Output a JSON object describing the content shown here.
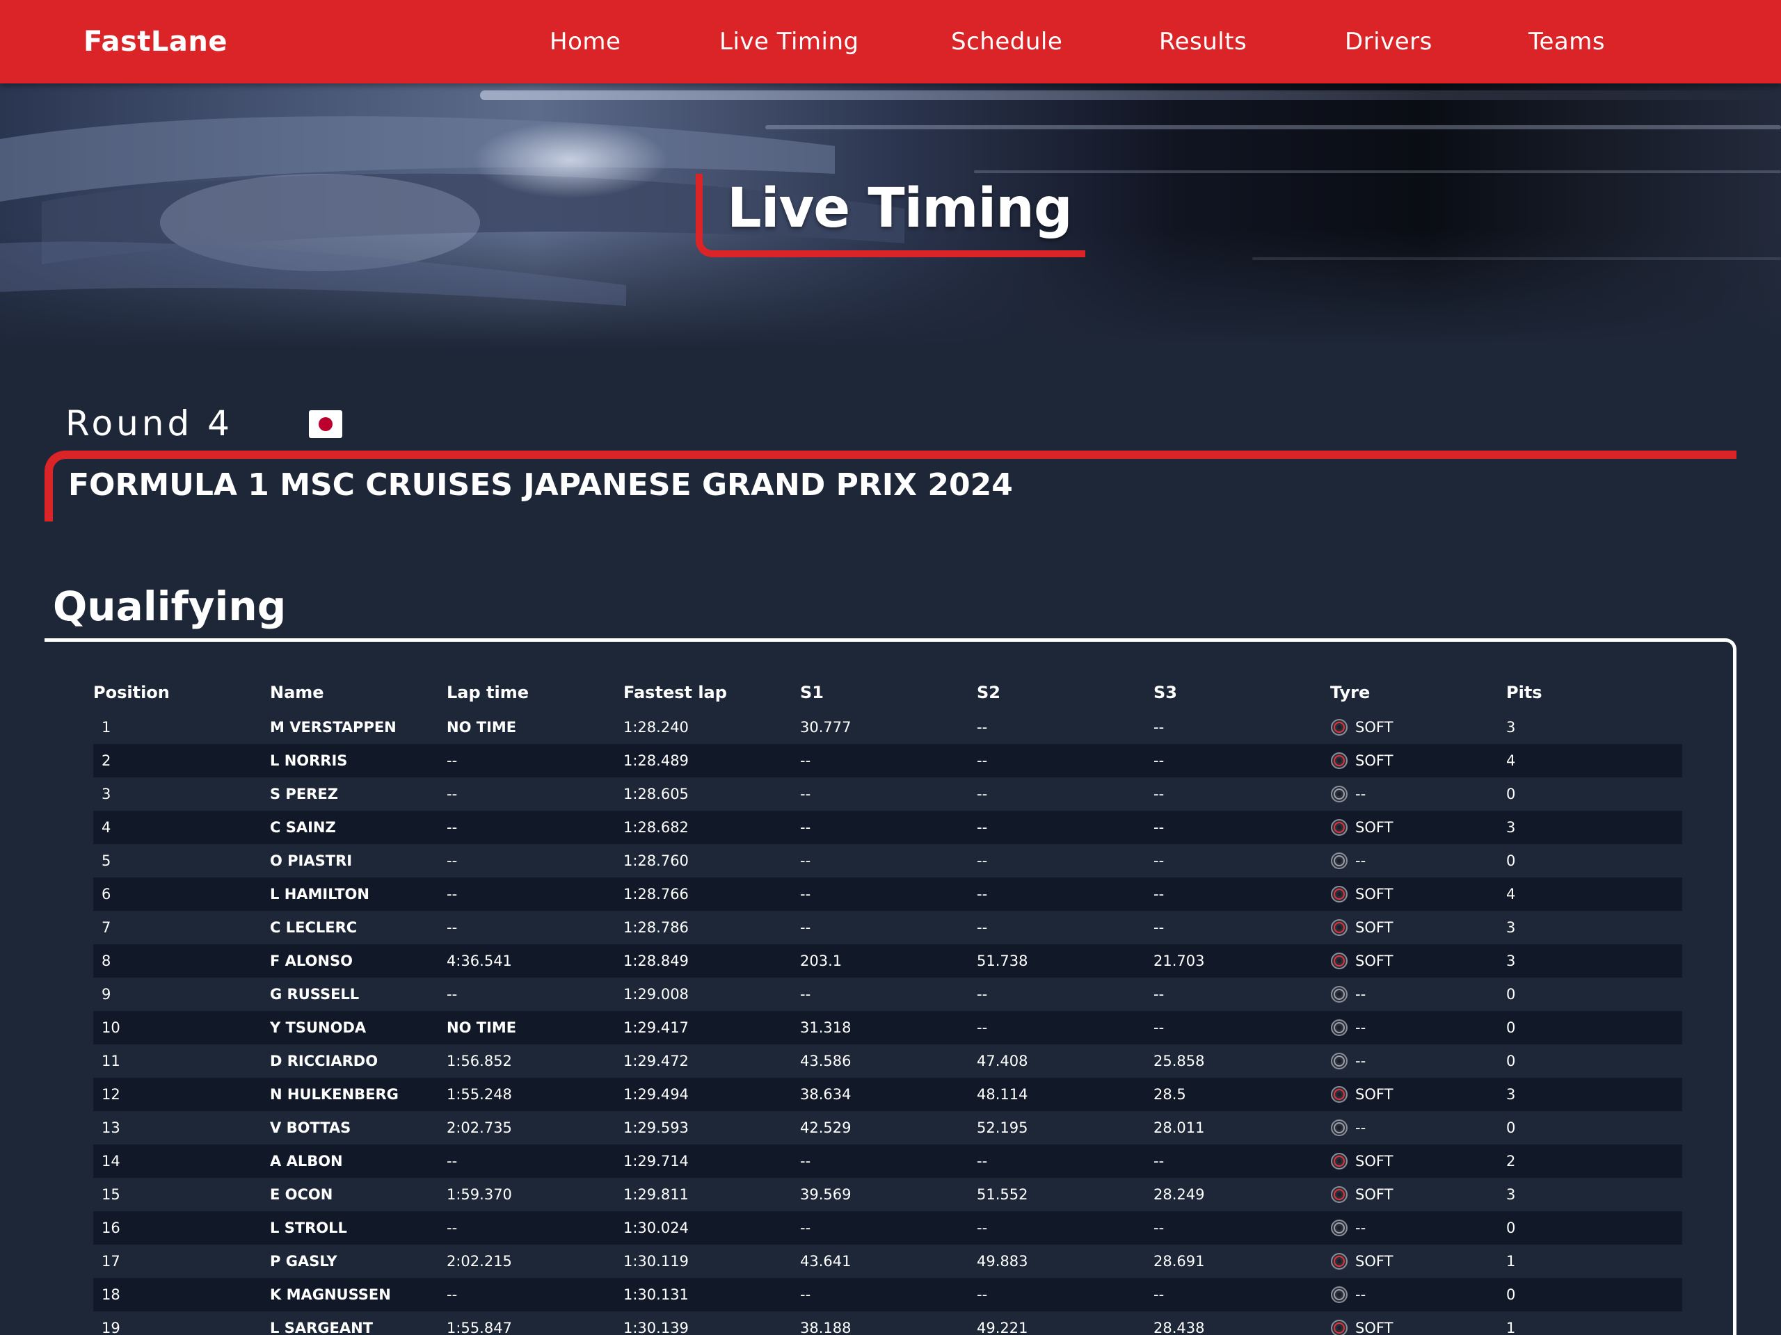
{
  "brand": "FastLane",
  "nav": [
    "Home",
    "Live Timing",
    "Schedule",
    "Results",
    "Drivers",
    "Teams"
  ],
  "hero": {
    "title": "Live Timing"
  },
  "event": {
    "round": "Round 4",
    "title": "FORMULA 1 MSC CRUISES JAPANESE GRAND PRIX 2024"
  },
  "session": {
    "title": "Qualifying"
  },
  "table": {
    "headers": [
      "Position",
      "Name",
      "Lap time",
      "Fastest lap",
      "S1",
      "S2",
      "S3",
      "Tyre",
      "Pits"
    ],
    "rows": [
      {
        "pos": "1",
        "name": "M VERSTAPPEN",
        "lap": "NO TIME",
        "fastest": "1:28.240",
        "s1": "30.777",
        "s2": "--",
        "s3": "--",
        "tyre": "SOFT",
        "pits": "3"
      },
      {
        "pos": "2",
        "name": "L NORRIS",
        "lap": "--",
        "fastest": "1:28.489",
        "s1": "--",
        "s2": "--",
        "s3": "--",
        "tyre": "SOFT",
        "pits": "4"
      },
      {
        "pos": "3",
        "name": "S PEREZ",
        "lap": "--",
        "fastest": "1:28.605",
        "s1": "--",
        "s2": "--",
        "s3": "--",
        "tyre": "--",
        "pits": "0"
      },
      {
        "pos": "4",
        "name": "C SAINZ",
        "lap": "--",
        "fastest": "1:28.682",
        "s1": "--",
        "s2": "--",
        "s3": "--",
        "tyre": "SOFT",
        "pits": "3"
      },
      {
        "pos": "5",
        "name": "O PIASTRI",
        "lap": "--",
        "fastest": "1:28.760",
        "s1": "--",
        "s2": "--",
        "s3": "--",
        "tyre": "--",
        "pits": "0"
      },
      {
        "pos": "6",
        "name": "L HAMILTON",
        "lap": "--",
        "fastest": "1:28.766",
        "s1": "--",
        "s2": "--",
        "s3": "--",
        "tyre": "SOFT",
        "pits": "4"
      },
      {
        "pos": "7",
        "name": "C LECLERC",
        "lap": "--",
        "fastest": "1:28.786",
        "s1": "--",
        "s2": "--",
        "s3": "--",
        "tyre": "SOFT",
        "pits": "3"
      },
      {
        "pos": "8",
        "name": "F ALONSO",
        "lap": "4:36.541",
        "fastest": "1:28.849",
        "s1": "203.1",
        "s2": "51.738",
        "s3": "21.703",
        "tyre": "SOFT",
        "pits": "3"
      },
      {
        "pos": "9",
        "name": "G RUSSELL",
        "lap": "--",
        "fastest": "1:29.008",
        "s1": "--",
        "s2": "--",
        "s3": "--",
        "tyre": "--",
        "pits": "0"
      },
      {
        "pos": "10",
        "name": "Y TSUNODA",
        "lap": "NO TIME",
        "fastest": "1:29.417",
        "s1": "31.318",
        "s2": "--",
        "s3": "--",
        "tyre": "--",
        "pits": "0"
      },
      {
        "pos": "11",
        "name": "D RICCIARDO",
        "lap": "1:56.852",
        "fastest": "1:29.472",
        "s1": "43.586",
        "s2": "47.408",
        "s3": "25.858",
        "tyre": "--",
        "pits": "0"
      },
      {
        "pos": "12",
        "name": "N HULKENBERG",
        "lap": "1:55.248",
        "fastest": "1:29.494",
        "s1": "38.634",
        "s2": "48.114",
        "s3": "28.5",
        "tyre": "SOFT",
        "pits": "3"
      },
      {
        "pos": "13",
        "name": "V BOTTAS",
        "lap": "2:02.735",
        "fastest": "1:29.593",
        "s1": "42.529",
        "s2": "52.195",
        "s3": "28.011",
        "tyre": "--",
        "pits": "0"
      },
      {
        "pos": "14",
        "name": "A ALBON",
        "lap": "--",
        "fastest": "1:29.714",
        "s1": "--",
        "s2": "--",
        "s3": "--",
        "tyre": "SOFT",
        "pits": "2"
      },
      {
        "pos": "15",
        "name": "E OCON",
        "lap": "1:59.370",
        "fastest": "1:29.811",
        "s1": "39.569",
        "s2": "51.552",
        "s3": "28.249",
        "tyre": "SOFT",
        "pits": "3"
      },
      {
        "pos": "16",
        "name": "L STROLL",
        "lap": "--",
        "fastest": "1:30.024",
        "s1": "--",
        "s2": "--",
        "s3": "--",
        "tyre": "--",
        "pits": "0"
      },
      {
        "pos": "17",
        "name": "P GASLY",
        "lap": "2:02.215",
        "fastest": "1:30.119",
        "s1": "43.641",
        "s2": "49.883",
        "s3": "28.691",
        "tyre": "SOFT",
        "pits": "1"
      },
      {
        "pos": "18",
        "name": "K MAGNUSSEN",
        "lap": "--",
        "fastest": "1:30.131",
        "s1": "--",
        "s2": "--",
        "s3": "--",
        "tyre": "--",
        "pits": "0"
      },
      {
        "pos": "19",
        "name": "L SARGEANT",
        "lap": "1:55.847",
        "fastest": "1:30.139",
        "s1": "38.188",
        "s2": "49.221",
        "s3": "28.438",
        "tyre": "SOFT",
        "pits": "1"
      }
    ]
  },
  "colors": {
    "accent": "#da2427",
    "background": "#1e2738",
    "row_alt": "#111827",
    "soft_tyre": "#e2323c",
    "unknown_tyre": "#9aa0aa"
  },
  "icons": {
    "tyre": "tyre-icon",
    "flag": "japan-flag-icon"
  }
}
